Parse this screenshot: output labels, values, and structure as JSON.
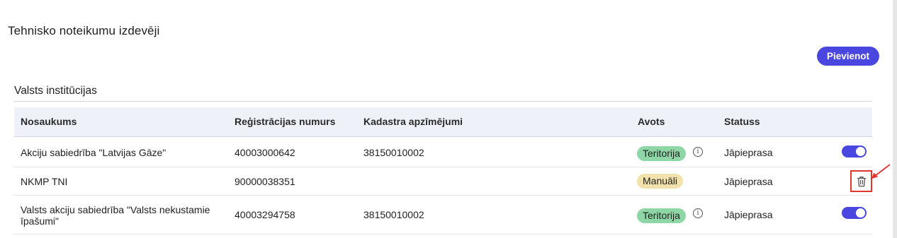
{
  "page": {
    "title": "Tehnisko noteikumu izdevēji"
  },
  "toolbar": {
    "add_label": "Pievienot"
  },
  "section": {
    "title": "Valsts institūcijas"
  },
  "table": {
    "headers": {
      "name": "Nosaukums",
      "reg": "Reģistrācijas numurs",
      "cadastre": "Kadastra apzīmējumi",
      "source": "Avots",
      "status": "Statuss"
    },
    "rows": [
      {
        "name": "Akciju sabiedrība \"Latvijas Gāze\"",
        "reg": "40003000642",
        "cadastre": "38150010002",
        "source": "Teritorija",
        "source_color": "#8fd6a6",
        "status": "Jāpieprasa",
        "enabled": true
      },
      {
        "name": "NKMP TNI",
        "reg": "90000038351",
        "cadastre": "",
        "source": "Manuāli",
        "source_color": "#f1e1ab",
        "status": "Jāpieprasa",
        "action": "trash-icon"
      },
      {
        "name_line1": "Valsts akciju sabiedrība \"Valsts nekustamie",
        "name_line2": "īpašumi\"",
        "reg": "40003294758",
        "cadastre": "38150010002",
        "source": "Teritorija",
        "source_color": "#8fd6a6",
        "status": "Jāpieprasa",
        "enabled": true
      }
    ]
  },
  "info_glyph": "i",
  "colors": {
    "accent": "#4a47e0",
    "highlight": "#e4342e"
  }
}
